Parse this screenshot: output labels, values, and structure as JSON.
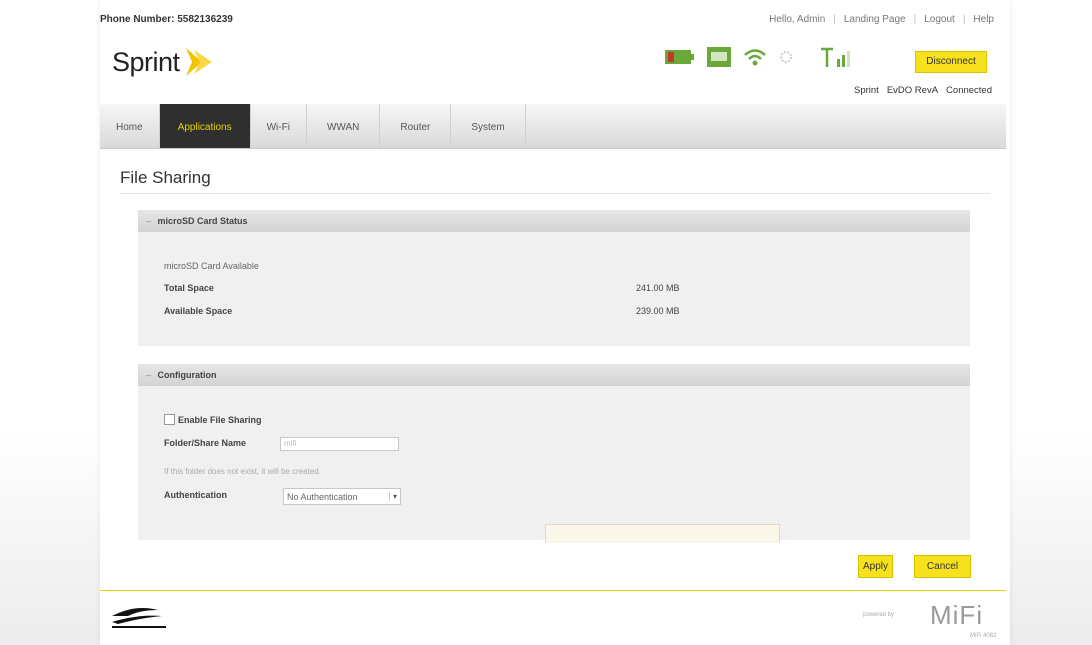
{
  "header": {
    "phone_label": "Phone Number: 5582136239",
    "links": [
      "Hello, Admin",
      "Landing Page",
      "Logout",
      "Help"
    ],
    "logo_text": "Sprint",
    "disconnect_label": "Disconnect",
    "status": [
      "Sprint",
      "EvDO RevA",
      "Connected"
    ]
  },
  "nav": {
    "tabs": [
      "Home",
      "Applications",
      "Wi-Fi",
      "WWAN",
      "Router",
      "System"
    ],
    "active": "Applications"
  },
  "page": {
    "title": "File Sharing"
  },
  "sd_panel": {
    "header": "microSD Card Status",
    "available_text": "microSD Card Available",
    "total_label": "Total Space",
    "total_value": "241.00 MB",
    "avail_label": "Available Space",
    "avail_value": "239.00 MB"
  },
  "config_panel": {
    "header": "Configuration",
    "enable_label": "Enable File Sharing",
    "folder_label": "Folder/Share Name",
    "folder_value": "mifi",
    "hint": "If this folder does not exist, it will be created.",
    "auth_label": "Authentication",
    "auth_value": "No Authentication"
  },
  "actions": {
    "apply": "Apply",
    "cancel": "Cancel"
  },
  "footer": {
    "brand": "MiFi",
    "powered": "powered by",
    "model": "MiFi 4082"
  },
  "colors": {
    "accent": "#f7e11d",
    "nav_active_bg": "#2f2f2f"
  }
}
